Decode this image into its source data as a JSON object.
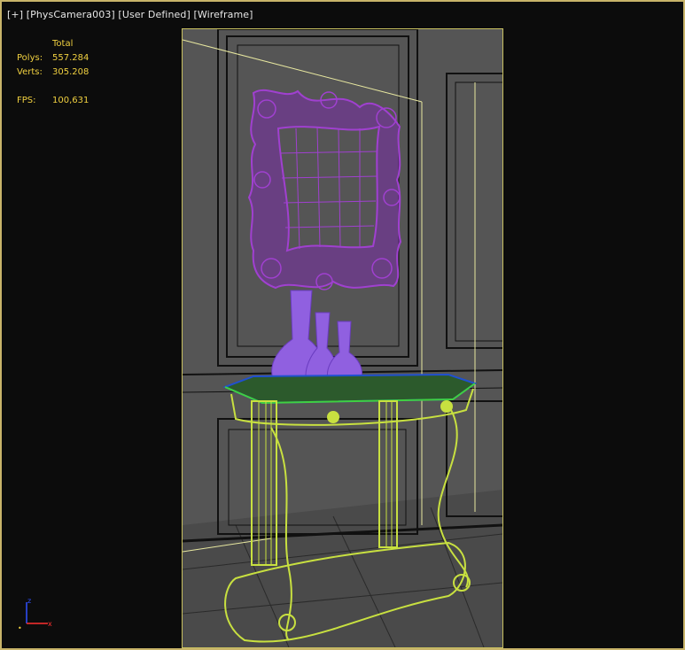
{
  "viewport": {
    "menu_plus": "[+]",
    "camera": "[PhysCamera003]",
    "shading": "[User Defined]",
    "display_mode": "[Wireframe]"
  },
  "stats": {
    "header": "Total",
    "polys_label": "Polys:",
    "polys_value": "557.284",
    "verts_label": "Verts:",
    "verts_value": "305.208",
    "fps_label": "FPS:",
    "fps_value": "100,631"
  },
  "axis_gizmo": {
    "x_label": "x",
    "z_label": "z"
  },
  "colors": {
    "frame_border": "#c8b46a",
    "stats_text": "#f0d040",
    "mirror_wire": "#a040d0",
    "vase_fill": "#9060e0",
    "table_wire": "#c8e040",
    "wall_wire": "#000000"
  }
}
